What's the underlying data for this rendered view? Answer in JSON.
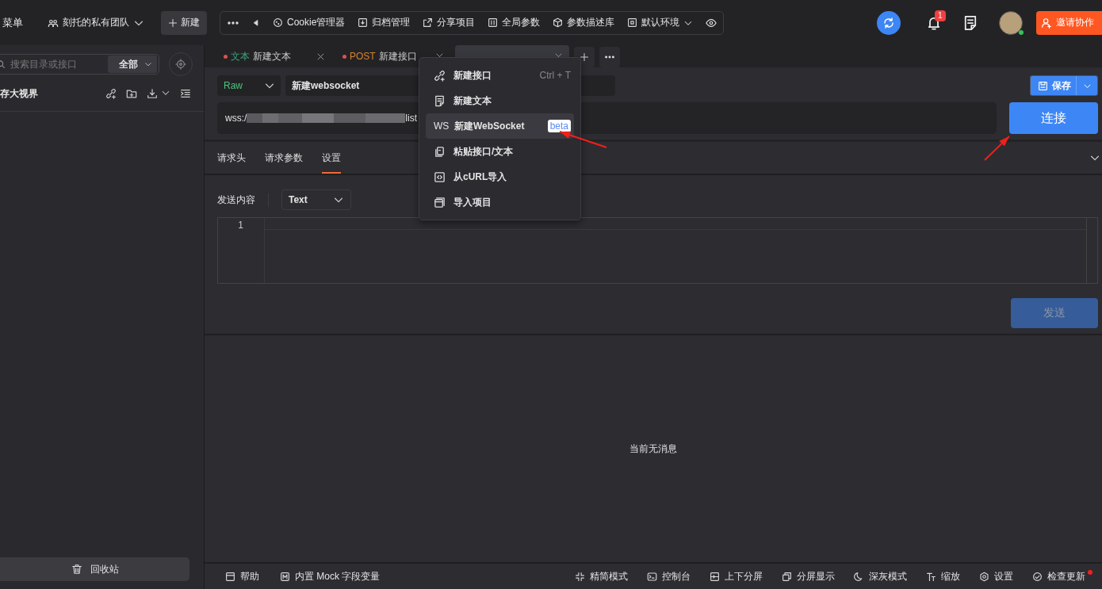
{
  "top_bar": {
    "menu_label": "菜单",
    "team": "刻托的私有团队",
    "new_button": "新建",
    "toolbar": [
      "Cookie管理器",
      "归档管理",
      "分享项目",
      "全局参数",
      "参数描述库",
      "默认环境"
    ],
    "notification_count": "1",
    "invite_button": "邀请协作"
  },
  "sidebar": {
    "search": {
      "placeholder": "搜索目录或接口"
    },
    "filter": "全部",
    "project": "存大视界",
    "trash_button": "回收站"
  },
  "tabs": [
    {
      "method": "文本",
      "title": "新建文本",
      "color": "#3aa57a",
      "selected": false
    },
    {
      "method": "POST",
      "title": "新建接口",
      "color": "#d9822b",
      "selected": false
    },
    {
      "selected": true
    }
  ],
  "request": {
    "mode": "Raw",
    "name": "新建websocket",
    "save_button": "保存",
    "url_prefix": "wss:/",
    "url_suffix": "list",
    "connect_button": "连接"
  },
  "sub_tabs": [
    {
      "label": "请求头",
      "selected": false
    },
    {
      "label": "请求参数",
      "selected": false
    },
    {
      "label": "设置",
      "selected": true
    }
  ],
  "settings": {
    "send_content_label": "发送内容",
    "content_type": "Text",
    "line_numbers": [
      "1"
    ],
    "send_button": {
      "label": "发送",
      "disabled": true
    }
  },
  "messages": {
    "empty_text": "当前无消息"
  },
  "menu": [
    {
      "label": "新建接口",
      "shortcut": "Ctrl + T",
      "highlighted": false
    },
    {
      "label": "新建文本",
      "highlighted": false
    },
    {
      "label": "新建WebSocket",
      "icon_text": "WS",
      "badge": "beta",
      "highlighted": true
    },
    {
      "label": "粘贴接口/文本",
      "highlighted": false
    },
    {
      "label": "从cURL导入",
      "highlighted": false
    },
    {
      "label": "导入项目",
      "highlighted": false
    }
  ],
  "status_bar": {
    "left": [
      "帮助",
      "内置 Mock 字段变量"
    ],
    "right": [
      {
        "label": "精简模式",
        "update_dot": false
      },
      {
        "label": "控制台",
        "update_dot": false
      },
      {
        "label": "上下分屏",
        "update_dot": false
      },
      {
        "label": "分屏显示",
        "update_dot": false
      },
      {
        "label": "深灰模式",
        "update_dot": false
      },
      {
        "label": "缩放",
        "update_dot": false
      },
      {
        "label": "设置",
        "update_dot": false
      },
      {
        "label": "检查更新",
        "update_dot": true
      }
    ]
  }
}
